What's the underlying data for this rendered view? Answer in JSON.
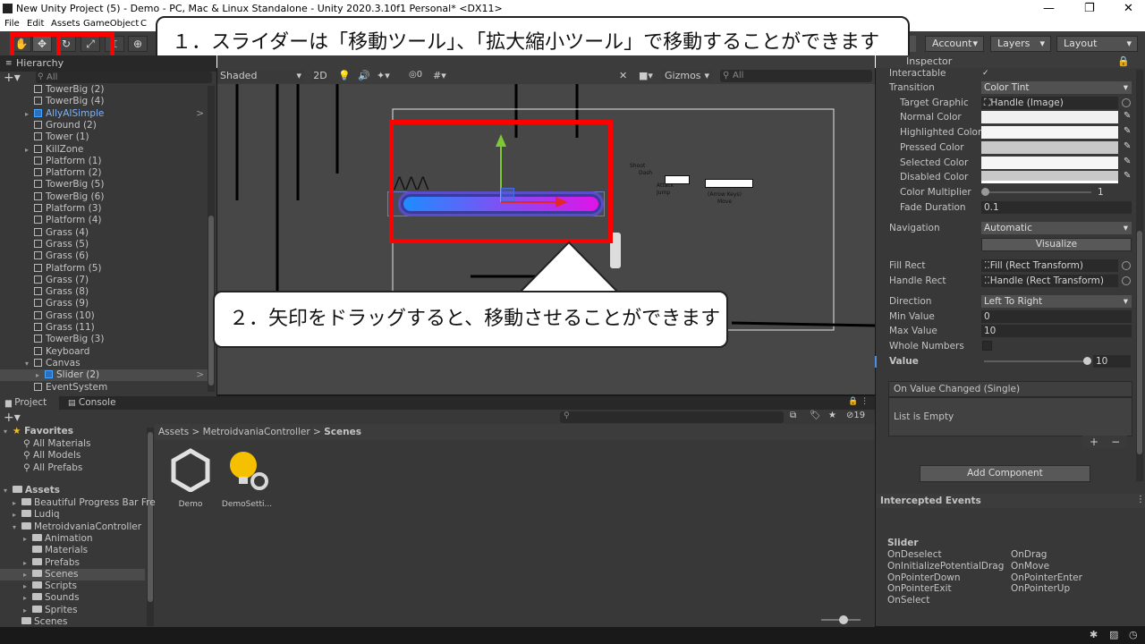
{
  "window": {
    "title": "New Unity Project (5) - Demo - PC, Mac & Linux Standalone - Unity 2020.3.10f1 Personal* <DX11>"
  },
  "menu": {
    "items": [
      "File",
      "Edit",
      "Assets",
      "GameObject",
      "C"
    ]
  },
  "toolbar": {
    "account": "Account",
    "layers": "Layers",
    "layout": "Layout"
  },
  "callouts": {
    "first": "１．スライダーは「移動ツール」、「拡大縮小ツール」で移動することができます",
    "second": "２．矢印をドラッグすると、移動させることができます"
  },
  "hierarchy": {
    "title": "Hierarchy",
    "search_placeholder": "All",
    "items": [
      {
        "label": "TowerBig (2)",
        "indent": 1
      },
      {
        "label": "TowerBig (4)",
        "indent": 1
      },
      {
        "label": "AllyAISimple",
        "indent": 1,
        "prefab": true
      },
      {
        "label": "Ground (2)",
        "indent": 1
      },
      {
        "label": "Tower (1)",
        "indent": 1
      },
      {
        "label": "KillZone",
        "indent": 1
      },
      {
        "label": "Platform (1)",
        "indent": 1
      },
      {
        "label": "Platform (2)",
        "indent": 1
      },
      {
        "label": "TowerBig (5)",
        "indent": 1
      },
      {
        "label": "TowerBig (6)",
        "indent": 1
      },
      {
        "label": "Platform (3)",
        "indent": 1
      },
      {
        "label": "Platform (4)",
        "indent": 1
      },
      {
        "label": "Grass (4)",
        "indent": 1
      },
      {
        "label": "Grass (5)",
        "indent": 1
      },
      {
        "label": "Grass (6)",
        "indent": 1
      },
      {
        "label": "Platform (5)",
        "indent": 1
      },
      {
        "label": "Grass (7)",
        "indent": 1
      },
      {
        "label": "Grass (8)",
        "indent": 1
      },
      {
        "label": "Grass (9)",
        "indent": 1
      },
      {
        "label": "Grass (10)",
        "indent": 1
      },
      {
        "label": "Grass (11)",
        "indent": 1
      },
      {
        "label": "TowerBig (3)",
        "indent": 1
      },
      {
        "label": "Keyboard",
        "indent": 1
      },
      {
        "label": "Canvas",
        "indent": 1
      },
      {
        "label": "Slider (2)",
        "indent": 2,
        "prefab": true,
        "selected": true
      },
      {
        "label": "EventSystem",
        "indent": 1
      }
    ]
  },
  "scene": {
    "shading": "Shaded",
    "mode_2d": "2D",
    "hidden_count": "0",
    "gizmos": "Gizmos",
    "search_placeholder": "All",
    "controls_labels": {
      "shoot": "Shoot",
      "dash": "Dash",
      "attack": "Attack",
      "jump": "Jump",
      "arrow_keys": "(Arrow Keys)",
      "move": "Move"
    }
  },
  "inspector": {
    "title": "Inspector",
    "rows": {
      "interactable": "Interactable",
      "transition": "Transition",
      "transition_value": "Color Tint",
      "target_graphic": "Target Graphic",
      "target_graphic_value": "Handle (Image)",
      "normal_color": "Normal Color",
      "highlighted_color": "Highlighted Color",
      "pressed_color": "Pressed Color",
      "selected_color": "Selected Color",
      "disabled_color": "Disabled Color",
      "color_multiplier": "Color Multiplier",
      "color_multiplier_value": "1",
      "fade_duration": "Fade Duration",
      "fade_duration_value": "0.1",
      "navigation": "Navigation",
      "navigation_value": "Automatic",
      "visualize": "Visualize",
      "fill_rect": "Fill Rect",
      "fill_rect_value": "Fill (Rect Transform)",
      "handle_rect": "Handle Rect",
      "handle_rect_value": "Handle (Rect Transform)",
      "direction": "Direction",
      "direction_value": "Left To Right",
      "min_value": "Min Value",
      "min_value_value": "0",
      "max_value": "Max Value",
      "max_value_value": "10",
      "whole_numbers": "Whole Numbers",
      "value": "Value",
      "value_value": "10"
    },
    "event_title": "On Value Changed (Single)",
    "event_empty": "List is Empty",
    "add_component": "Add Component",
    "intercepted_title": "Intercepted Events",
    "intercepted_object": "Slider",
    "events_left": [
      "OnDeselect",
      "OnInitializePotentialDrag",
      "OnPointerDown",
      "OnPointerExit",
      "OnSelect"
    ],
    "events_right": [
      "OnDrag",
      "OnMove",
      "OnPointerEnter",
      "OnPointerUp"
    ]
  },
  "project": {
    "tab_project": "Project",
    "tab_console": "Console",
    "hidden_count": "19",
    "breadcrumb": [
      "Assets",
      "MetroidvaniaController",
      "Scenes"
    ],
    "favorites": {
      "label": "Favorites",
      "items": [
        "All Materials",
        "All Models",
        "All Prefabs"
      ]
    },
    "assets": {
      "label": "Assets",
      "items": [
        {
          "label": "Beautiful Progress Bar Fre",
          "indent": 1
        },
        {
          "label": "Ludiq",
          "indent": 1
        },
        {
          "label": "MetroidvaniaController",
          "indent": 1
        },
        {
          "label": "Animation",
          "indent": 2
        },
        {
          "label": "Materials",
          "indent": 2
        },
        {
          "label": "Prefabs",
          "indent": 2
        },
        {
          "label": "Scenes",
          "indent": 2,
          "selected": true
        },
        {
          "label": "Scripts",
          "indent": 2
        },
        {
          "label": "Sounds",
          "indent": 2
        },
        {
          "label": "Sprites",
          "indent": 2
        },
        {
          "label": "Scenes",
          "indent": 1
        }
      ]
    },
    "files": [
      {
        "label": "Demo",
        "icon": "unity-scene-icon"
      },
      {
        "label": "DemoSetti...",
        "icon": "lighting-settings-icon"
      }
    ]
  },
  "colors": {
    "slider_start": "#1e8cff",
    "slider_end": "#e014e8",
    "highlight": "#ff0000",
    "y_axis": "#7ec836",
    "x_axis": "#e8262a"
  }
}
